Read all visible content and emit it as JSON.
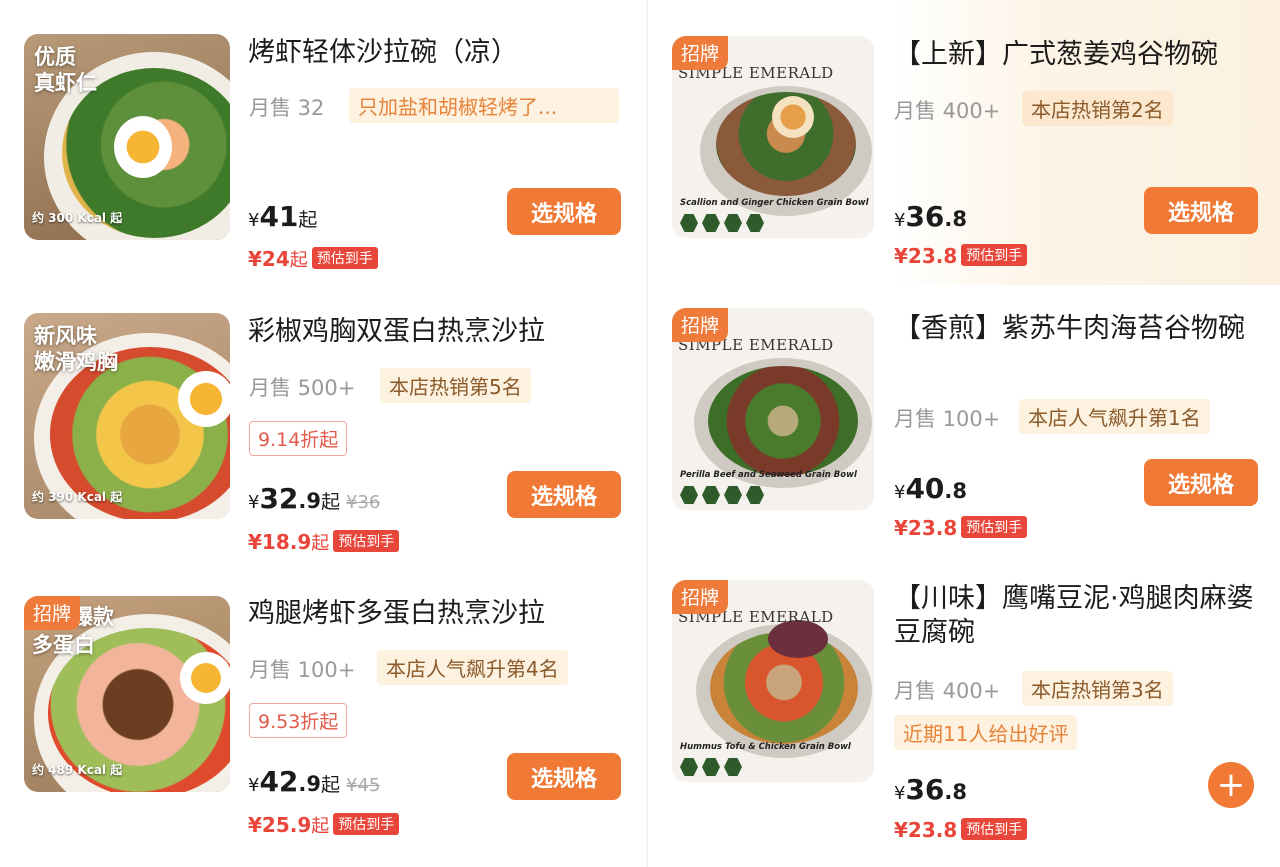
{
  "colors": {
    "accent": "#ef7935",
    "price_red": "#e8463a",
    "tag_bg": "#fdf1df"
  },
  "left": [
    {
      "overlay": [
        "优质",
        "真虾仁"
      ],
      "kcal": "约 300 Kcal 起",
      "title": "烤虾轻体沙拉碗（凉）",
      "sales": "月售 32",
      "tag": "只加盐和胡椒轻烤了...",
      "price_int": "41",
      "price_dec": "",
      "price_suffix": "起",
      "orig_price": "",
      "est_price": "¥24",
      "est_suffix": "起",
      "est_badge": "预估到手",
      "button": "选规格"
    },
    {
      "overlay": [
        "新风味",
        "嫩滑鸡胸"
      ],
      "kcal": "约 390 Kcal 起",
      "title": "彩椒鸡胸双蛋白热烹沙拉",
      "sales": "月售 500+",
      "tag": "本店热销第5名",
      "discount": "9.14折起",
      "price_int": "32",
      "price_dec": ".9",
      "price_suffix": "起",
      "orig_price": "¥36",
      "est_price": "¥18.9",
      "est_suffix": "起",
      "est_badge": "预估到手",
      "button": "选规格"
    },
    {
      "badge": "招牌",
      "overlay": [
        "爆款",
        "多蛋白"
      ],
      "kcal": "约 489 Kcal 起",
      "title": "鸡腿烤虾多蛋白热烹沙拉",
      "sales": "月售 100+",
      "tag": "本店人气飙升第4名",
      "discount": "9.53折起",
      "price_int": "42",
      "price_dec": ".9",
      "price_suffix": "起",
      "orig_price": "¥45",
      "est_price": "¥25.9",
      "est_suffix": "起",
      "est_badge": "预估到手",
      "button": "选规格"
    }
  ],
  "right": [
    {
      "badge": "招牌",
      "brand": "SIMPLE EMERALD",
      "eng": "Scallion and Ginger Chicken Grain Bowl",
      "title": "【上新】广式葱姜鸡谷物碗",
      "sales": "月售 400+",
      "tag": "本店热销第2名",
      "price_int": "36",
      "price_dec": ".8",
      "est_price": "¥23.8",
      "est_badge": "预估到手",
      "button": "选规格"
    },
    {
      "badge": "招牌",
      "brand": "SIMPLE EMERALD",
      "eng": "Perilla Beef and Seaweed Grain Bowl",
      "title": "【香煎】紫苏牛肉海苔谷物碗",
      "sales": "月售 100+",
      "tag": "本店人气飙升第1名",
      "price_int": "40",
      "price_dec": ".8",
      "est_price": "¥23.8",
      "est_badge": "预估到手",
      "button": "选规格"
    },
    {
      "badge": "招牌",
      "brand": "SIMPLE EMERALD",
      "eng": "Hummus Tofu & Chicken Grain Bowl",
      "title": "【川味】鹰嘴豆泥·鸡腿肉麻婆豆腐碗",
      "sales": "月售 400+",
      "tag": "本店热销第3名",
      "tag2": "近期11人给出好评",
      "price_int": "36",
      "price_dec": ".8",
      "est_price": "¥23.8",
      "est_badge": "预估到手",
      "button": "+"
    }
  ]
}
